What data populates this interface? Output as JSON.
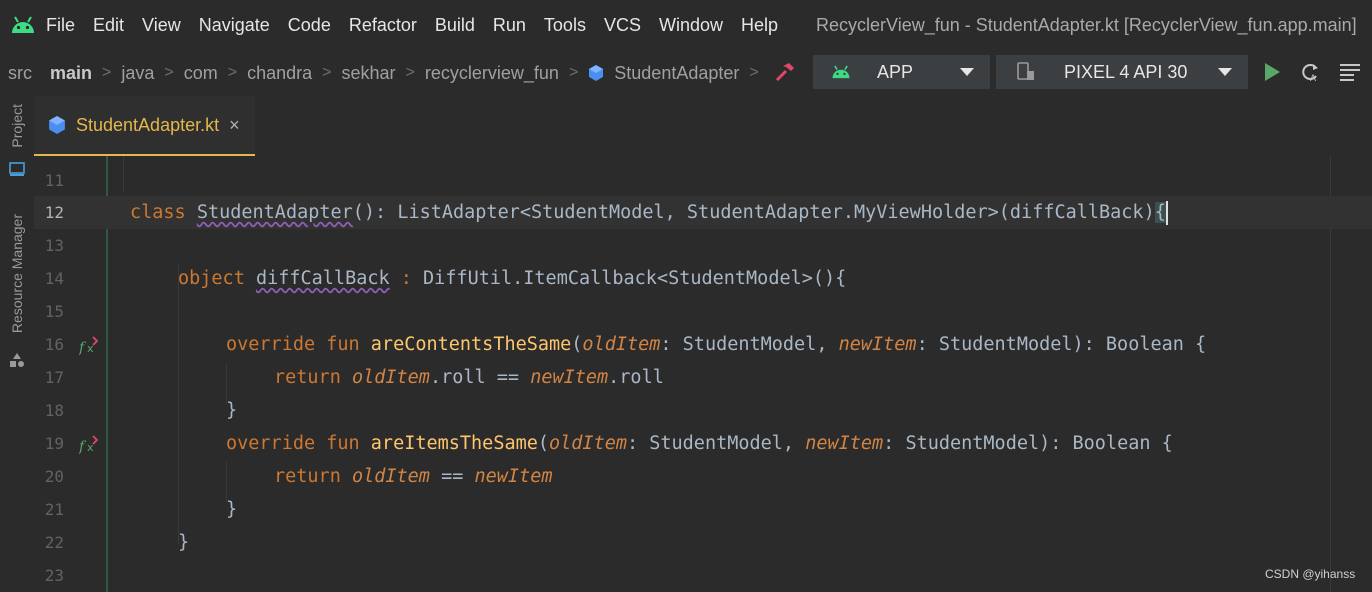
{
  "menubar": {
    "items": [
      "File",
      "Edit",
      "View",
      "Navigate",
      "Code",
      "Refactor",
      "Build",
      "Run",
      "Tools",
      "VCS",
      "Window",
      "Help"
    ],
    "window_title": "RecyclerView_fun - StudentAdapter.kt [RecyclerView_fun.app.main]"
  },
  "breadcrumbs": {
    "items": [
      "src",
      "main",
      "java",
      "com",
      "chandra",
      "sekhar",
      "recyclerview_fun",
      "StudentAdapter"
    ]
  },
  "toolbar": {
    "run_config": "APP",
    "device": "PIXEL 4 API 30"
  },
  "side_panels": {
    "project": "Project",
    "resource_manager": "Resource Manager"
  },
  "tabs": [
    {
      "label": "StudentAdapter.kt",
      "close": "×"
    }
  ],
  "editor": {
    "current_line": "12",
    "line_numbers": [
      "11",
      "12",
      "13",
      "14",
      "15",
      "16",
      "17",
      "18",
      "19",
      "20",
      "21",
      "22",
      "23"
    ]
  },
  "watermark": "CSDN @yihanss",
  "colors": {
    "background": "#2b2b2b",
    "keyword": "#cc7832",
    "function": "#ffc66d",
    "tab_accent": "#e4b64b",
    "run_green": "#59a869"
  }
}
